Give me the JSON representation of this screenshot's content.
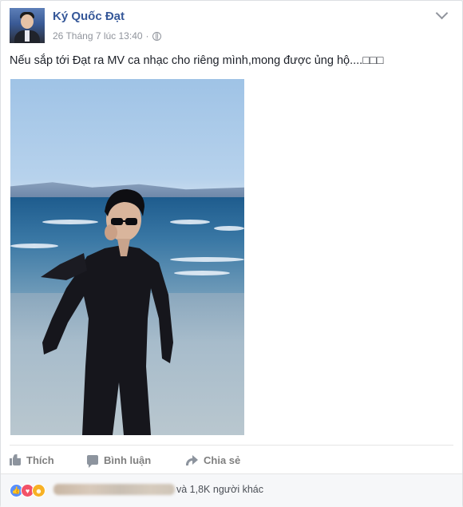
{
  "post": {
    "author_name": "Ký Quốc Đạt",
    "timestamp": "26 Tháng 7 lúc 13:40",
    "separator": "·",
    "privacy_icon": "globe-icon",
    "text": "Nếu sắp tới Đạt ra MV ca nhạc cho riêng mình,mong được ủng hộ....□□□"
  },
  "actions": {
    "like_label": "Thích",
    "comment_label": "Bình luận",
    "share_label": "Chia sẻ"
  },
  "reactions": {
    "icons": [
      "like-icon",
      "love-icon",
      "haha-icon"
    ],
    "others_text": "và 1,8K người khác"
  },
  "colors": {
    "author_link": "#365899",
    "meta_gray": "#90949c",
    "action_gray": "#7f7f7f",
    "like_blue": "#5890ff",
    "love_red": "#f25268",
    "haha_yellow": "#f7b125"
  }
}
